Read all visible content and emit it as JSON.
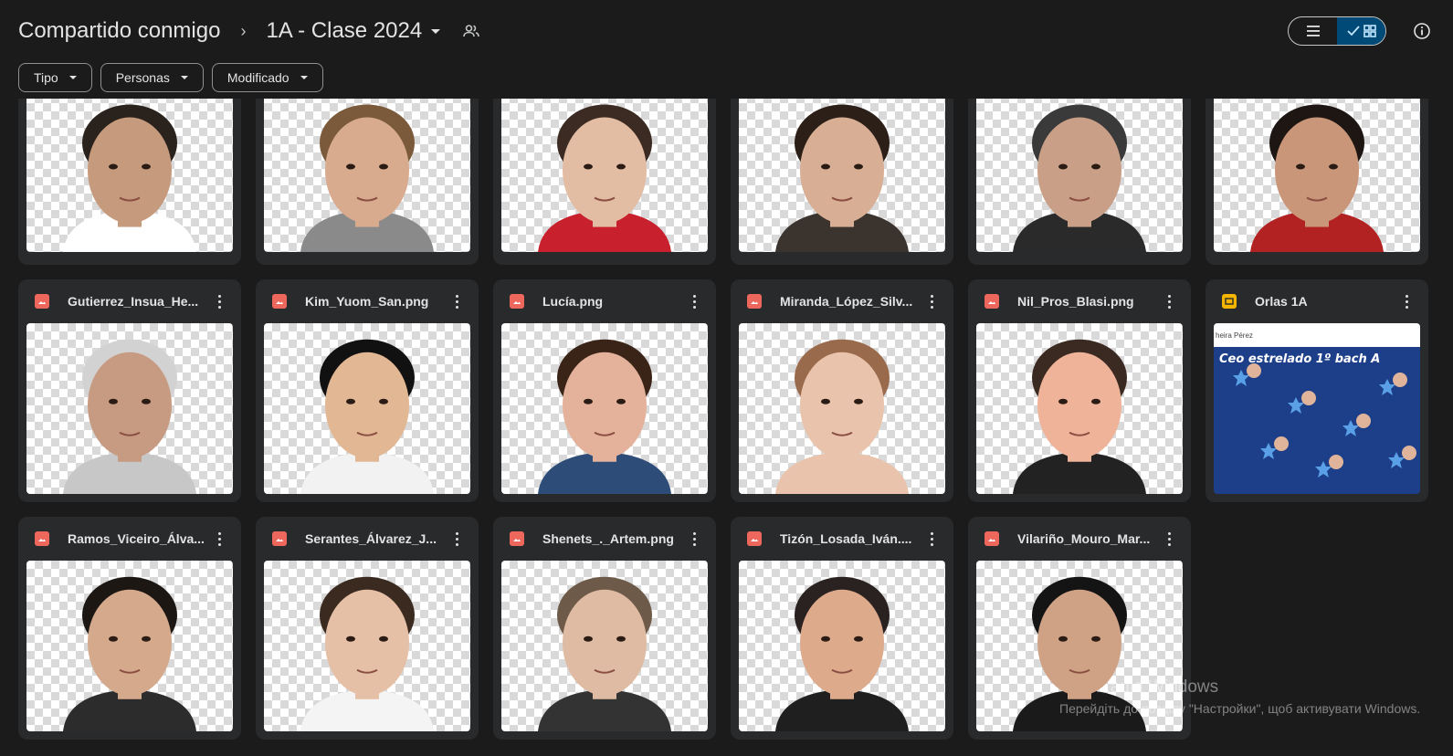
{
  "header": {
    "root": "Compartido conmigo",
    "separator": "›",
    "current_folder": "1A - Clase 2024"
  },
  "icons": {
    "shared": "shared-people-icon",
    "list_view": "list-view-icon",
    "grid_view": "grid-view-icon",
    "info": "info-icon",
    "image_file": "image-file-icon",
    "slides_file": "slides-file-icon",
    "more": "more-vertical-icon"
  },
  "filters": [
    "Tipo",
    "Personas",
    "Modificado"
  ],
  "files": [
    {
      "name": "",
      "type": "image",
      "skin": "#c69a7d",
      "hair": "#2a221c",
      "shirt": "#ffffff"
    },
    {
      "name": "",
      "type": "image",
      "skin": "#d8aa8e",
      "hair": "#7a5a3a",
      "shirt": "#8a8a8a"
    },
    {
      "name": "",
      "type": "image",
      "skin": "#e3bca4",
      "hair": "#3b2b22",
      "shirt": "#c8202c"
    },
    {
      "name": "",
      "type": "image",
      "skin": "#d8ae94",
      "hair": "#2b1f18",
      "shirt": "#3a332e"
    },
    {
      "name": "",
      "type": "image",
      "skin": "#c9a087",
      "hair": "#3a3a3a",
      "shirt": "#2a2a2a"
    },
    {
      "name": "",
      "type": "image",
      "skin": "#c99679",
      "hair": "#1e1612",
      "shirt": "#b22222"
    },
    {
      "name": "Gutierrez_Insua_He...",
      "type": "image",
      "skin": "#c79a82",
      "hair": "#d2d2d2",
      "shirt": "#c7c7c7"
    },
    {
      "name": "Kim_Yuom_San.png",
      "type": "image",
      "skin": "#e2b794",
      "hair": "#111111",
      "shirt": "#f2f2f2"
    },
    {
      "name": "Lucía.png",
      "type": "image",
      "skin": "#e4b29a",
      "hair": "#3a2418",
      "shirt": "#2d4c78"
    },
    {
      "name": "Miranda_López_Silv...",
      "type": "image",
      "skin": "#e9c3ab",
      "hair": "#9a6a4c",
      "shirt": "#e9c3ab"
    },
    {
      "name": "Nil_Pros_Blasi.png",
      "type": "image",
      "skin": "#efb39a",
      "hair": "#3a2a22",
      "shirt": "#222222"
    },
    {
      "name": "Orlas 1A",
      "type": "slides",
      "slide_top": "heira Pérez",
      "slide_title": "Ceo estrelado 1º bach A"
    },
    {
      "name": "Ramos_Viceiro_Álva...",
      "type": "image",
      "skin": "#d5a98c",
      "hair": "#1d1714",
      "shirt": "#2c2c2c"
    },
    {
      "name": "Serantes_Álvarez_J...",
      "type": "image",
      "skin": "#e6c0a6",
      "hair": "#3b2a20",
      "shirt": "#f4f4f4"
    },
    {
      "name": "Shenets_._Artem.png",
      "type": "image",
      "skin": "#dfbba4",
      "hair": "#6e5a48",
      "shirt": "#333333"
    },
    {
      "name": "Tizón_Losada_Iván....",
      "type": "image",
      "skin": "#deaa8c",
      "hair": "#2a2220",
      "shirt": "#1f1f1f"
    },
    {
      "name": "Vilariño_Mouro_Mar...",
      "type": "image",
      "skin": "#cfa285",
      "hair": "#141414",
      "shirt": "#1a1a1a"
    }
  ],
  "watermark": {
    "title": "...ація Windows",
    "subtitle": "Перейдіть до розділу \"Настройки\", щоб активувати Windows."
  }
}
